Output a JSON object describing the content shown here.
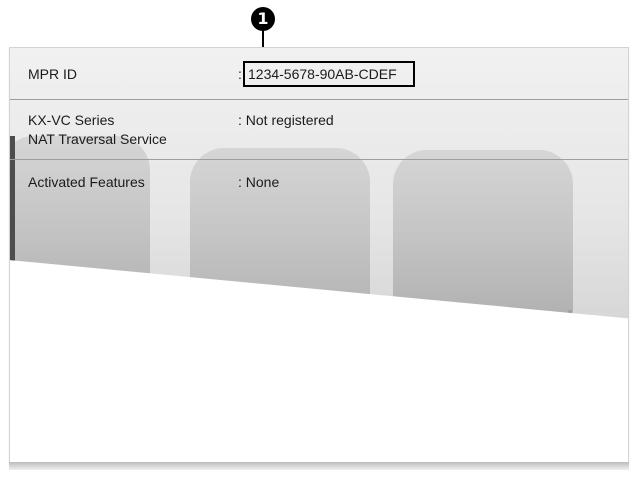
{
  "callout": {
    "marker": "1"
  },
  "info": {
    "mpr_id": {
      "label": "MPR ID",
      "colon": ":",
      "value": "1234-5678-90AB-CDEF"
    },
    "nat_service": {
      "label_line1": "KX-VC Series",
      "label_line2": "NAT Traversal Service",
      "value": ": Not registered"
    },
    "activated_features": {
      "label": "Activated Features",
      "value": ": None"
    }
  },
  "colors": {
    "text": "#1b1b1b",
    "divider": "#9e9e9e",
    "panel_border": "#d3d3d3",
    "callout": "#000000"
  }
}
